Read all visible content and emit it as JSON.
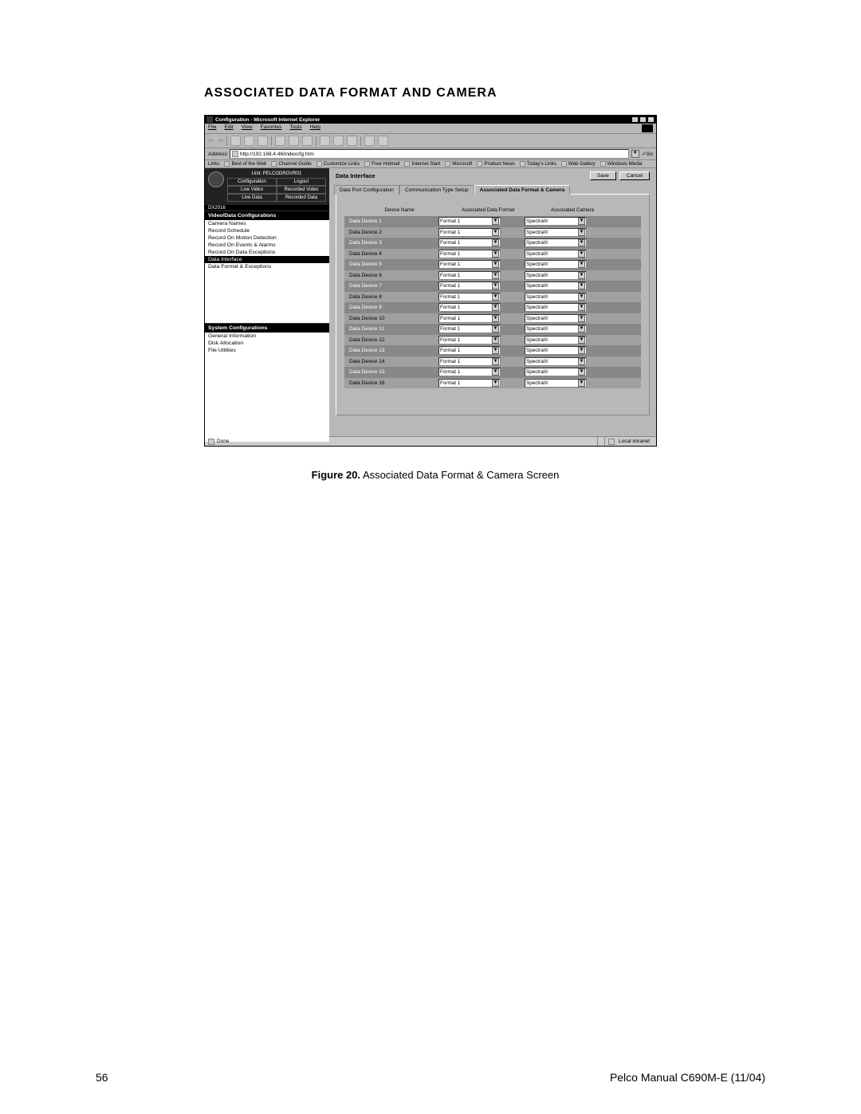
{
  "heading": "ASSOCIATED DATA FORMAT AND CAMERA",
  "caption_bold": "Figure 20.",
  "caption_rest": "  Associated Data Format & Camera Screen",
  "footer_left": "56",
  "footer_right": "Pelco Manual C690M-E (11/04)",
  "titlebar": "Configuration - Microsoft Internet Explorer",
  "menu": {
    "file": "File",
    "edit": "Edit",
    "view": "View",
    "favorites": "Favorites",
    "tools": "Tools",
    "help": "Help"
  },
  "address_label": "Address",
  "address_value": "http://192.168.4.46/indexcfg.htm",
  "go_label": "Go",
  "links_label": "Links",
  "links": [
    "Best of the Web",
    "Channel Guide",
    "Customize Links",
    "Free Hotmail",
    "Internet Start",
    "Microsoft",
    "Product News",
    "Today's Links",
    "Web Gallery",
    "Windows Media"
  ],
  "sidebar": {
    "unit": "Unit: PELCODROVR01",
    "model": "DX2016",
    "hdr": {
      "config": "Configuration",
      "logout": "Logout",
      "livevid": "Live Video",
      "recvid": "Recorded Video",
      "livedata": "Live Data",
      "recdata": "Recorded Data"
    },
    "section1": "Video/Data Configurations",
    "items1": [
      "Camera Names",
      "Record Schedule",
      "Record On Motion Detection",
      "Record On Events & Alarms",
      "Record On Data Exceptions",
      "Data Interface",
      "Data Format & Exceptions"
    ],
    "active1": 5,
    "section2": "System Configurations",
    "items2": [
      "General Information",
      "Disk Allocation",
      "File Utilities"
    ]
  },
  "main": {
    "title": "Data Interface",
    "save": "Save",
    "cancel": "Cancel",
    "tabs": [
      "Data Port Configuration",
      "Communication Type Setup",
      "Associated Data Format & Camera"
    ],
    "active_tab": 2,
    "col_device": "Device Name",
    "col_format": "Associated Data Format",
    "col_camera": "Associated Camera",
    "format_value": "Format 1",
    "camera_value": "SpectraIII",
    "devices": [
      "Data Device 1",
      "Data Device 2",
      "Data Device 3",
      "Data Device 4",
      "Data Device 5",
      "Data Device 6",
      "Data Device 7",
      "Data Device 8",
      "Data Device 9",
      "Data Device 10",
      "Data Device 11",
      "Data Device 12",
      "Data Device 13",
      "Data Device 14",
      "Data Device 15",
      "Data Device 16"
    ]
  },
  "status": {
    "done": "Done",
    "zone": "Local intranet"
  }
}
